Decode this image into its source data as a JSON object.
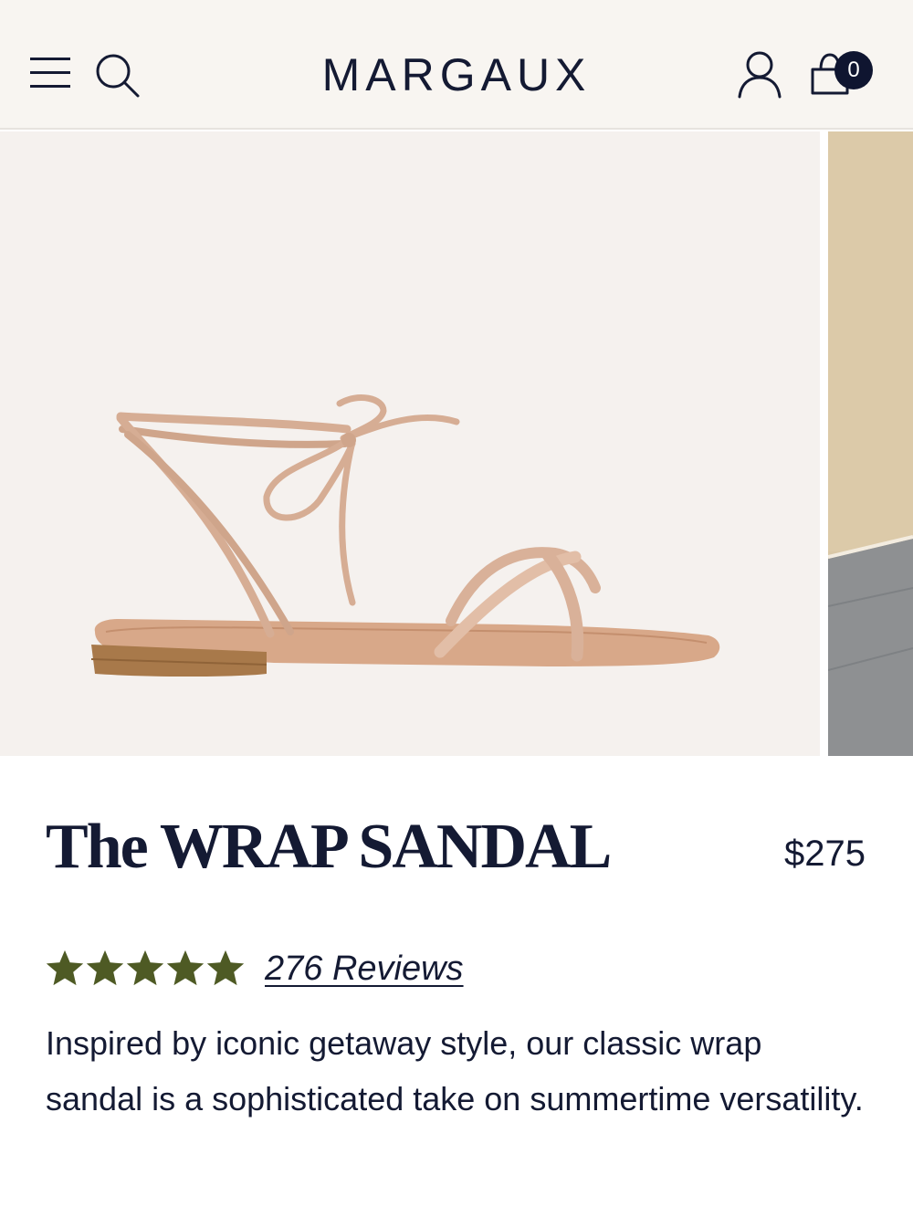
{
  "header": {
    "menu_icon": "hamburger-menu-icon",
    "search_icon": "search-icon",
    "logo": "MARGAUX",
    "account_icon": "user-icon",
    "cart_icon": "shopping-bag-icon",
    "cart_count": "0"
  },
  "product": {
    "title": "The WRAP SANDAL",
    "price": "$275",
    "rating": 5,
    "rating_max": 5,
    "reviews_label": "276 Reviews",
    "description": "Inspired by iconic getaway style, our classic wrap sandal is a sophisticated take on summertime versatility."
  },
  "colors": {
    "header_bg": "#f8f5f1",
    "text": "#141a33",
    "star": "#4e5a24",
    "badge_bg": "#0f1530",
    "image_bg": "#f5f1ee"
  }
}
